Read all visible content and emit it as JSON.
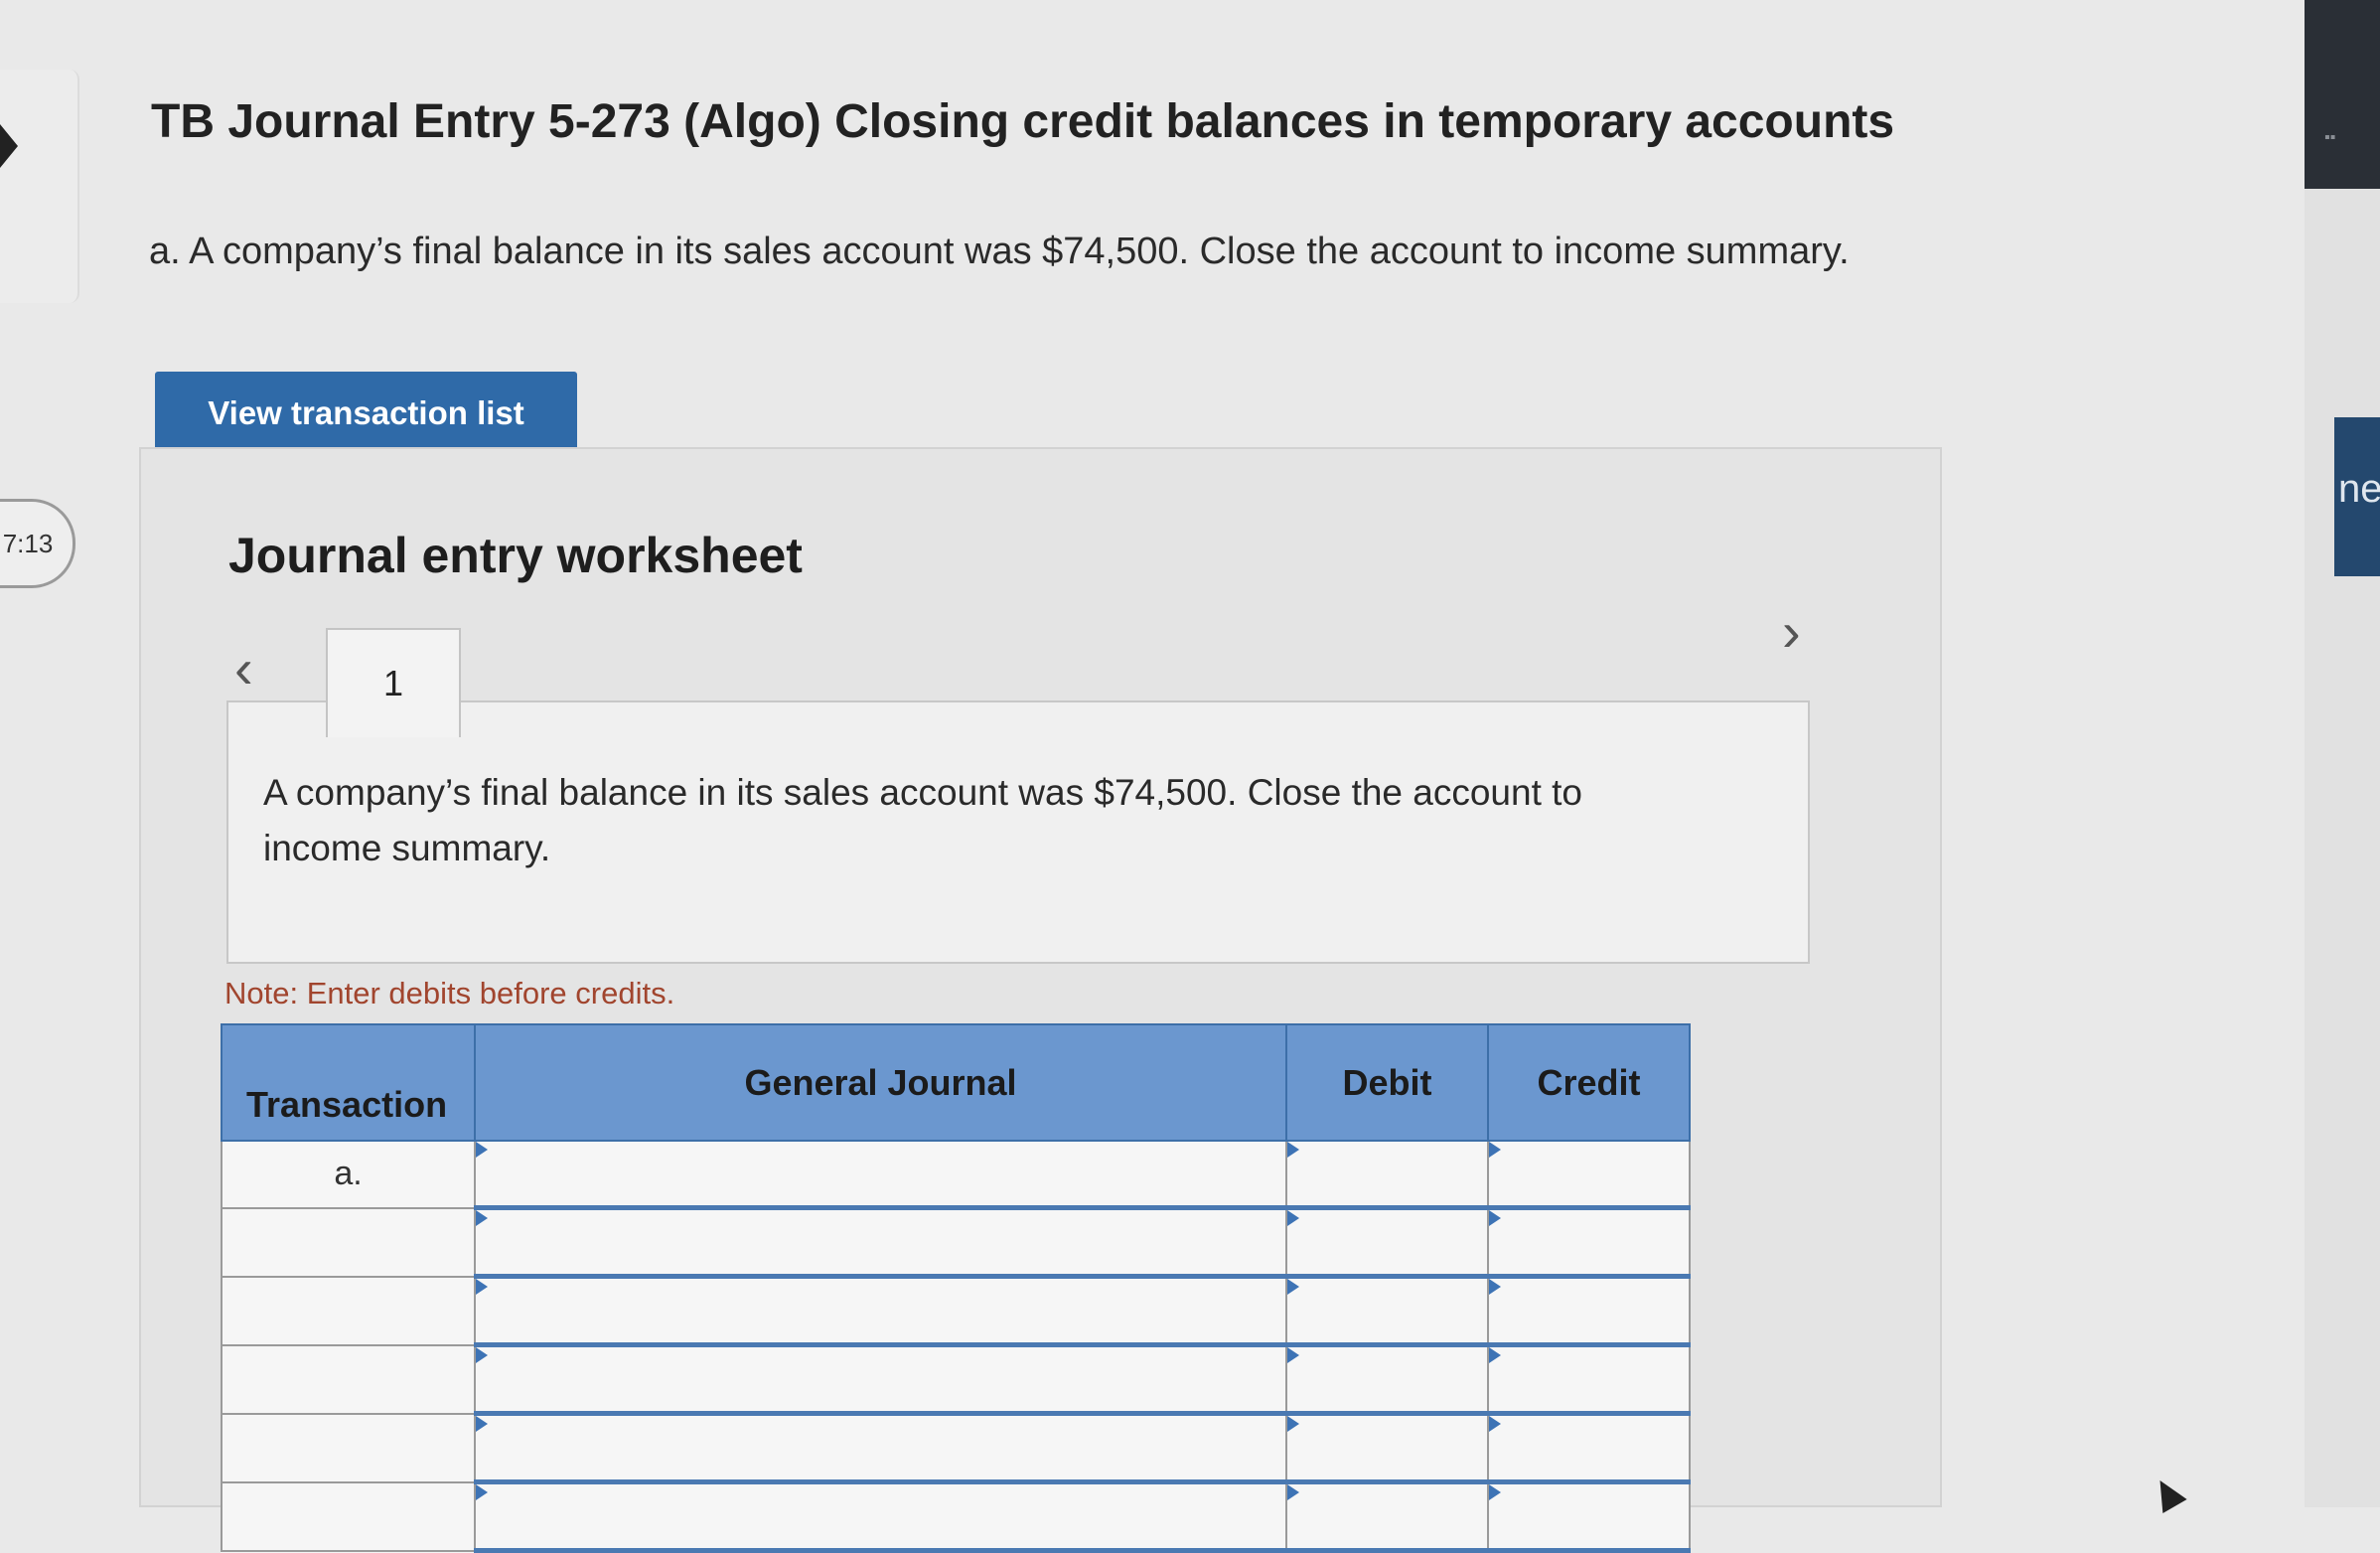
{
  "question": {
    "title": "TB Journal Entry 5-273 (Algo) Closing credit balances in temporary accounts",
    "prompt": "a. A company’s final balance in its sales account was $74,500. Close the account to income summary."
  },
  "timer": {
    "value": "7:13"
  },
  "buttons": {
    "view_transactions": "View transaction list"
  },
  "worksheet": {
    "title": "Journal entry worksheet",
    "nav": {
      "prev": "‹",
      "next": "›"
    },
    "tabs": [
      "1"
    ],
    "entry_prompt": "A company’s final balance in its sales account was $74,500. Close the account to income summary.",
    "note": "Note: Enter debits before credits.",
    "table": {
      "headers": {
        "transaction": "Transaction",
        "general_journal": "General Journal",
        "debit": "Debit",
        "credit": "Credit"
      },
      "rows": [
        {
          "transaction": "a.",
          "account": "",
          "debit": "",
          "credit": ""
        },
        {
          "transaction": "",
          "account": "",
          "debit": "",
          "credit": ""
        },
        {
          "transaction": "",
          "account": "",
          "debit": "",
          "credit": ""
        },
        {
          "transaction": "",
          "account": "",
          "debit": "",
          "credit": ""
        },
        {
          "transaction": "",
          "account": "",
          "debit": "",
          "credit": ""
        },
        {
          "transaction": "",
          "account": "",
          "debit": "",
          "credit": ""
        }
      ]
    }
  },
  "side_panel": {
    "partial_label": "ne"
  }
}
